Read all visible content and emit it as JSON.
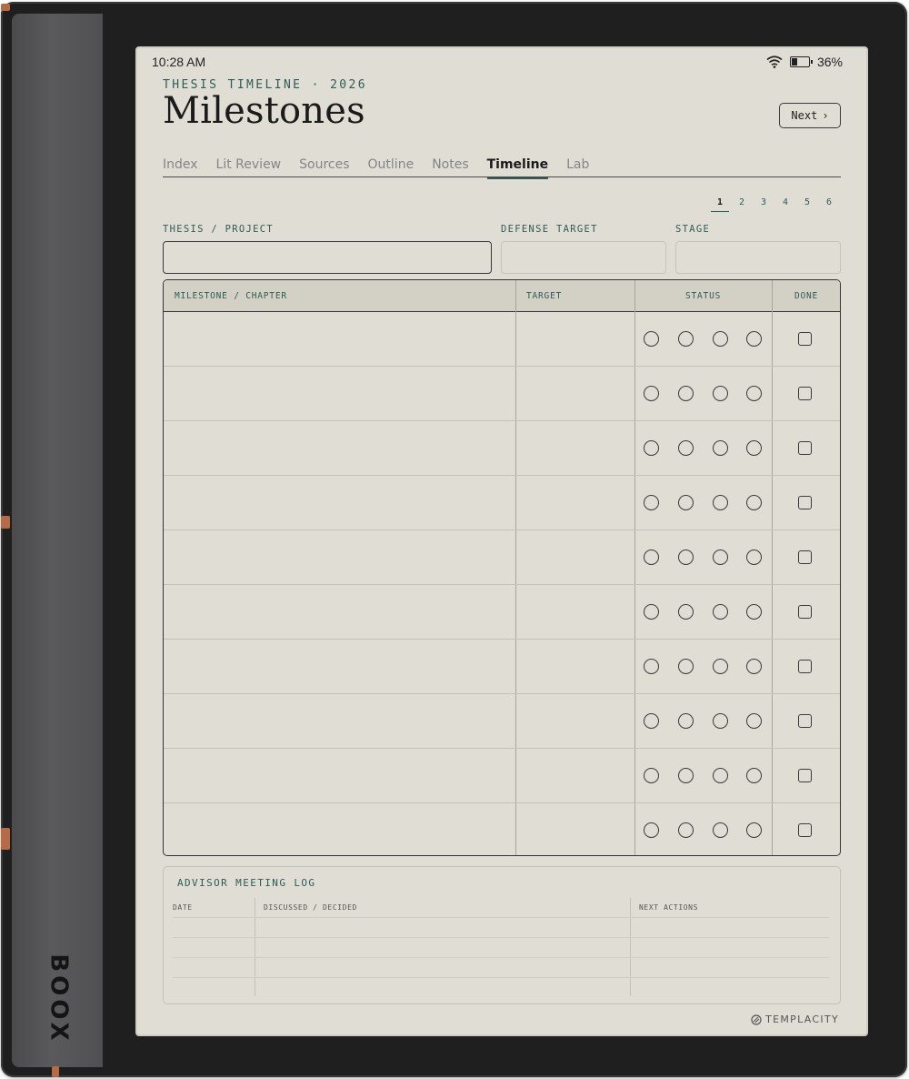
{
  "device": {
    "brand": "BOOX"
  },
  "status_bar": {
    "time": "10:28 AM",
    "battery_percent": "36%",
    "battery_level": 0.36
  },
  "header": {
    "eyebrow": "THESIS TIMELINE · 2026",
    "title": "Milestones",
    "next_label": "Next",
    "next_chevron": "›"
  },
  "tabs": [
    {
      "label": "Index",
      "active": false
    },
    {
      "label": "Lit Review",
      "active": false
    },
    {
      "label": "Sources",
      "active": false
    },
    {
      "label": "Outline",
      "active": false
    },
    {
      "label": "Notes",
      "active": false
    },
    {
      "label": "Timeline",
      "active": true
    },
    {
      "label": "Lab",
      "active": false
    }
  ],
  "pager": {
    "pages": [
      "1",
      "2",
      "3",
      "4",
      "5",
      "6"
    ],
    "current": "1"
  },
  "fields": {
    "project_label": "THESIS / PROJECT",
    "defense_label": "DEFENSE TARGET",
    "stage_label": "STAGE"
  },
  "milestone_table": {
    "headers": {
      "milestone": "MILESTONE / CHAPTER",
      "target": "TARGET",
      "status": "STATUS",
      "done": "DONE"
    },
    "row_count": 10,
    "status_circles_per_row": 4
  },
  "advisor_log": {
    "title": "ADVISOR MEETING LOG",
    "columns": [
      "DATE",
      "DISCUSSED / DECIDED",
      "NEXT ACTIONS"
    ]
  },
  "footer": {
    "logo_text": "TEMPLACITY"
  },
  "colors": {
    "accent": "#2f5d56",
    "paper": "#e0ddd4",
    "header_fill": "#d3d0c5",
    "ink": "#1b1b1b"
  }
}
